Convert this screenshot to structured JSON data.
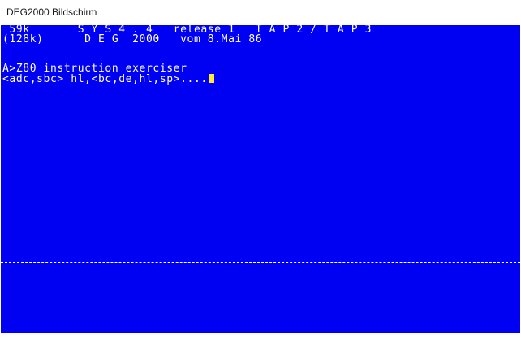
{
  "window": {
    "title": "DEG2000 Bildschirm"
  },
  "terminal": {
    "lines": [
      " 59k       S Y S 4 . 4   release 1   T A P 2 / T A P 3",
      "(128k)      D E G  2000   vom 8.Mai 86",
      "",
      "",
      "A>Z80 instruction exerciser",
      "<adc,sbc> hl,<bc,de,hl,sp>...."
    ]
  },
  "colors": {
    "screen_background": "#0000f2",
    "text": "#ffffff",
    "cursor": "#ffea30"
  }
}
